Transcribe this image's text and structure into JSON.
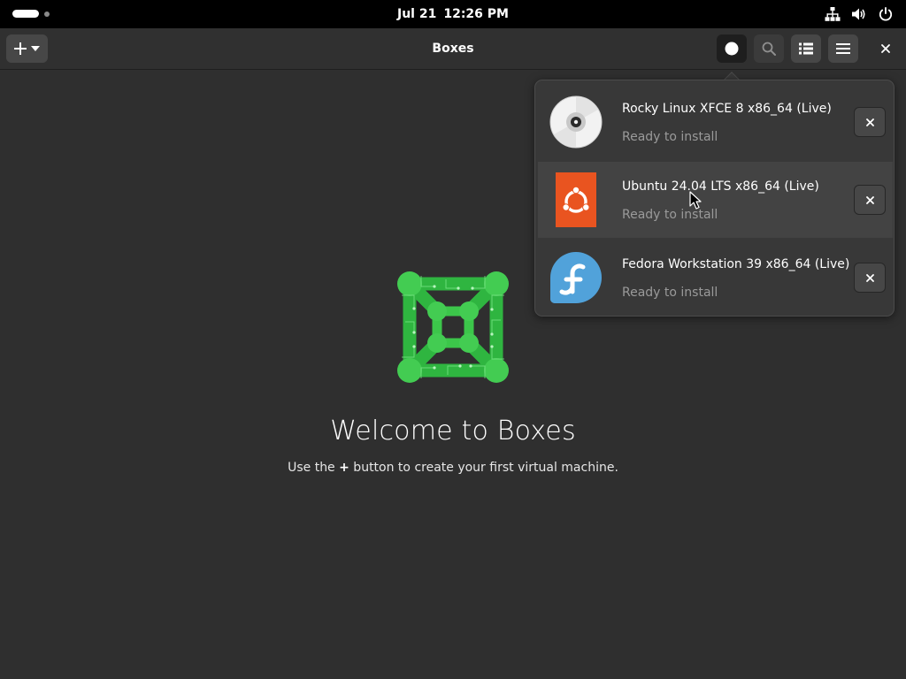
{
  "topbar": {
    "date": "Jul 21",
    "time": "12:26 PM",
    "tray_icons": [
      "network-icon",
      "volume-icon",
      "power-icon"
    ]
  },
  "headerbar": {
    "title": "Boxes",
    "new_button_icon": "plus-icon",
    "buttons": [
      "downloads-icon",
      "search-icon",
      "list-view-icon",
      "hamburger-menu-icon",
      "close-icon"
    ]
  },
  "welcome": {
    "title": "Welcome to Boxes",
    "subtitle_before": "Use the ",
    "subtitle_symbol": "+",
    "subtitle_after": " button to create your first virtual machine."
  },
  "downloads": {
    "items": [
      {
        "name": "Rocky Linux XFCE 8 x86_64 (Live)",
        "status": "Ready to install",
        "icon": "cd-disc-icon"
      },
      {
        "name": "Ubuntu 24.04 LTS x86_64 (Live)",
        "status": "Ready to install",
        "icon": "ubuntu-logo-icon"
      },
      {
        "name": "Fedora Workstation 39 x86_64 (Live)",
        "status": "Ready to install",
        "icon": "fedora-logo-icon"
      }
    ]
  },
  "colors": {
    "background": "#2f2f2f",
    "topbar": "#000000",
    "popover": "#383838",
    "ubuntu_orange": "#e95420",
    "fedora_blue": "#51a2da",
    "boxes_green": "#3cc64a"
  }
}
